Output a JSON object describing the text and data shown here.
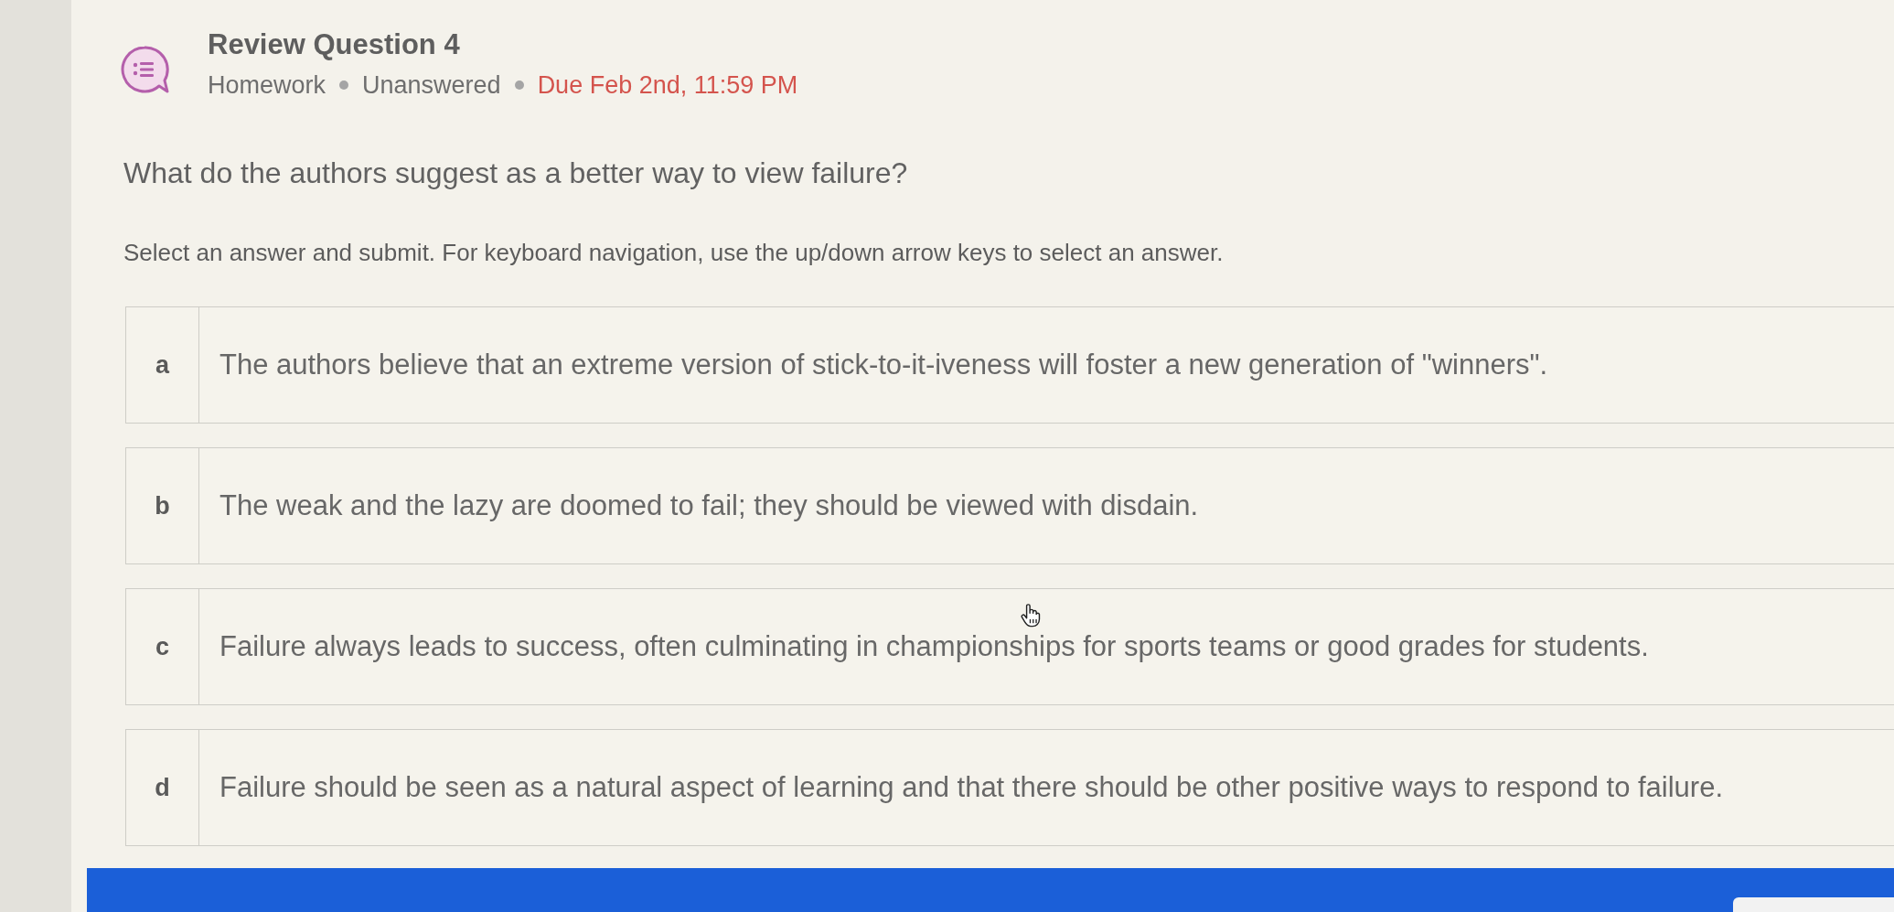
{
  "header": {
    "title": "Review Question 4",
    "meta": [
      {
        "text": "Homework",
        "kind": "plain"
      },
      {
        "text": "Unanswered",
        "kind": "plain"
      },
      {
        "text": "Due Feb 2nd, 11:59 PM",
        "kind": "due"
      }
    ]
  },
  "question": "What do the authors suggest as a better way to view failure?",
  "instructions": "Select an answer and submit. For keyboard navigation, use the up/down arrow keys to select an answer.",
  "options": [
    {
      "letter": "a",
      "text": "The authors believe that an extreme version of stick-to-it-iveness will foster a new generation of \"winners\".",
      "selected": false
    },
    {
      "letter": "b",
      "text": "The weak and the lazy are doomed to fail; they should be viewed with disdain.",
      "selected": false
    },
    {
      "letter": "c",
      "text": "Failure always leads to success, often culminating in championships for sports teams or good grades for students.",
      "selected": false
    },
    {
      "letter": "d",
      "text": "Failure should be seen as a natural aspect of learning and that there should be other positive ways to respond to failure.",
      "selected": false
    }
  ]
}
